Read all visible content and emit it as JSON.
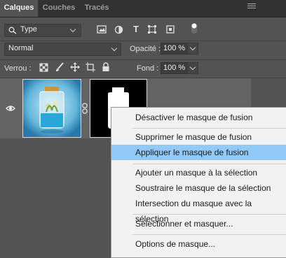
{
  "tabs": [
    {
      "label": "Calques",
      "active": true
    },
    {
      "label": "Couches",
      "active": false
    },
    {
      "label": "Tracés",
      "active": false
    }
  ],
  "filter": {
    "kind_label": "Type"
  },
  "blend": {
    "mode": "Normal",
    "opacity_label": "Opacité :",
    "opacity_value": "100 %"
  },
  "lock": {
    "label": "Verrou :",
    "fill_label": "Fond :",
    "fill_value": "100 %"
  },
  "context_menu": {
    "items": [
      {
        "label": "Désactiver le masque de fusion"
      },
      {
        "label": "Supprimer le masque de fusion"
      },
      {
        "label": "Appliquer le masque de fusion",
        "highlighted": true
      },
      {
        "label": "Ajouter un masque à la sélection"
      },
      {
        "label": "Soustraire le masque de la sélection"
      },
      {
        "label": "Intersection du masque avec la sélection"
      },
      {
        "label": "Sélectionner et masquer..."
      },
      {
        "label": "Options de masque..."
      }
    ]
  },
  "colors": {
    "panel_bg": "#535353",
    "highlight": "#91c9f7",
    "menu_bg": "#f2f2f2"
  }
}
